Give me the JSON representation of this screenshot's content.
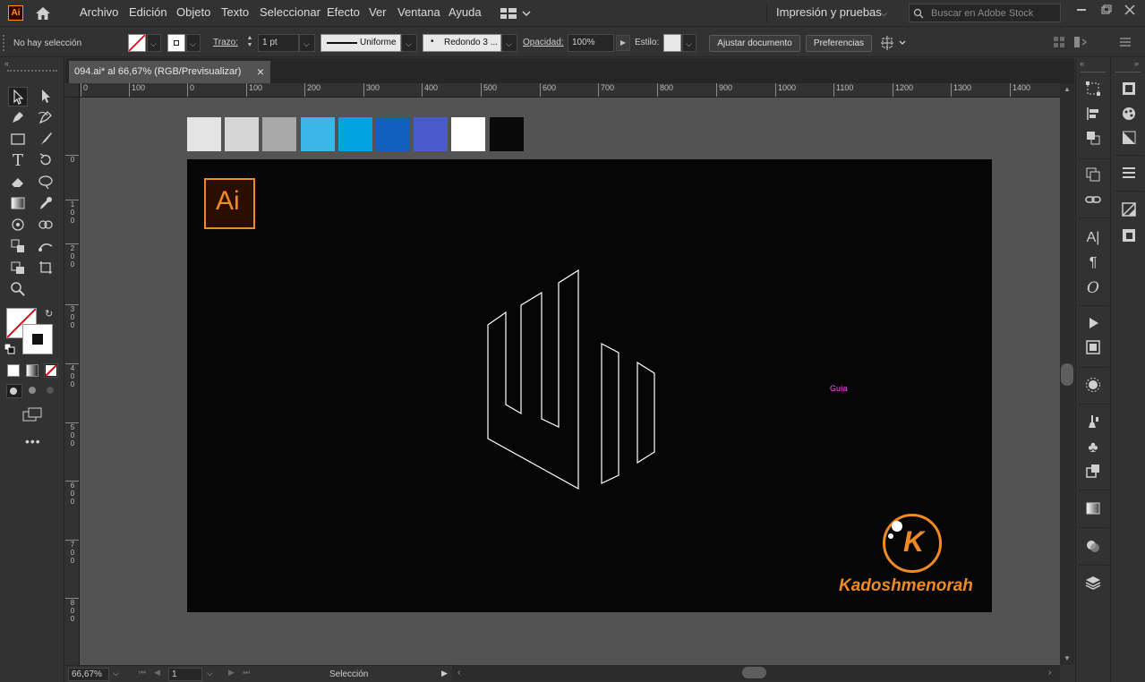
{
  "app": {
    "logo_text": "Ai"
  },
  "menu": {
    "items": [
      "Archivo",
      "Edición",
      "Objeto",
      "Texto",
      "Seleccionar",
      "Efecto",
      "Ver",
      "Ventana",
      "Ayuda"
    ],
    "workspace": "Impresión y pruebas",
    "search_placeholder": "Buscar en Adobe Stock"
  },
  "control": {
    "selection_status": "No hay selección",
    "stroke_label": "Trazo:",
    "stroke_weight": "1 pt",
    "stroke_profile": "Uniforme",
    "brush": "Redondo 3 ...",
    "opacity_label": "Opacidad:",
    "opacity_value": "100%",
    "style_label": "Estilo:",
    "adjust_document": "Ajustar documento",
    "preferences": "Preferencias"
  },
  "document": {
    "tab_title": "094.ai* al 66,67% (RGB/Previsualizar)",
    "close_symbol": "×"
  },
  "rulers": {
    "horizontal": [
      "0",
      "100",
      "0",
      "100",
      "200",
      "300",
      "400",
      "500",
      "600",
      "700",
      "800",
      "900",
      "1000",
      "1100",
      "1200",
      "1300",
      "1400"
    ],
    "vertical": [
      "0",
      "1\n0\n0",
      "2\n0\n0",
      "3\n0\n0",
      "4\n0\n0",
      "5\n0\n0",
      "6\n0\n0",
      "7\n0\n0",
      "8\n0\n0"
    ]
  },
  "swatches": [
    "#e4e4e4",
    "#d6d6d6",
    "#a9a9a9",
    "#3bb6e6",
    "#00a2e0",
    "#0f5fbf",
    "#4a5ccc",
    "#ffffff",
    "#0a0a0a"
  ],
  "artboard": {
    "ai_logo_text": "Ai",
    "guide_label": "Guía",
    "brand_letter": "K",
    "brand_name": "Kadoshmenorah",
    "brand_color": "#f08a24"
  },
  "status": {
    "zoom": "66,67%",
    "artboard_number": "1",
    "mode": "Selección"
  }
}
